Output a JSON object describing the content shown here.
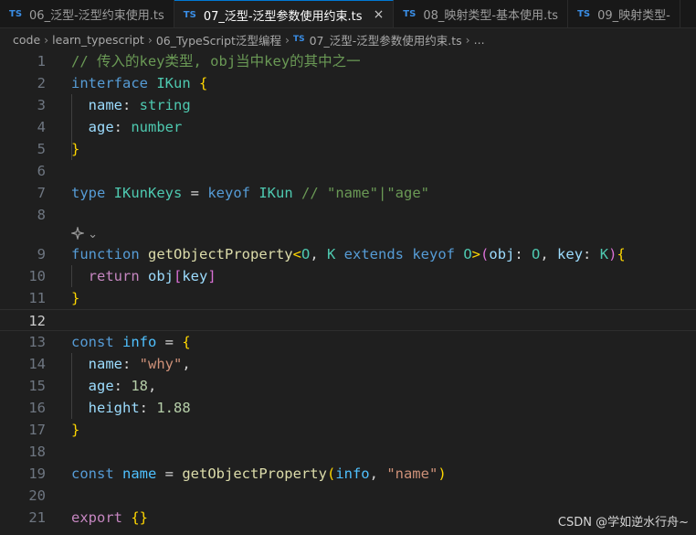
{
  "tabs": [
    {
      "badge": "TS",
      "label": "06_泛型-泛型约束使用.ts",
      "active": false
    },
    {
      "badge": "TS",
      "label": "07_泛型-泛型参数使用约束.ts",
      "active": true,
      "close": "×"
    },
    {
      "badge": "TS",
      "label": "08_映射类型-基本使用.ts",
      "active": false
    },
    {
      "badge": "TS",
      "label": "09_映射类型-",
      "active": false
    }
  ],
  "breadcrumb": {
    "segments": [
      "code",
      "learn_typescript",
      "06_TypeScript泛型编程"
    ],
    "file_badge": "TS",
    "file": "07_泛型-泛型参数使用约束.ts",
    "trailing": "...",
    "separator": "›"
  },
  "codelens": {
    "icon": "sparkle-icon",
    "chevron": "⌄"
  },
  "editor": {
    "current_line": 12,
    "line_numbers": [
      "1",
      "2",
      "3",
      "4",
      "5",
      "6",
      "7",
      "8",
      "9",
      "10",
      "11",
      "12",
      "13",
      "14",
      "15",
      "16",
      "17",
      "18",
      "19",
      "20",
      "21"
    ],
    "lines": [
      [
        [
          "tk-comment",
          "// 传入的key类型, obj当中key的其中之一"
        ]
      ],
      [
        [
          "tk-kw",
          "interface "
        ],
        [
          "tk-type",
          "IKun "
        ],
        [
          "tk-brace",
          "{"
        ]
      ],
      [
        [
          "tk-plain",
          "  "
        ],
        [
          "tk-prop",
          "name"
        ],
        [
          "tk-plain",
          ": "
        ],
        [
          "tk-type",
          "string"
        ]
      ],
      [
        [
          "tk-plain",
          "  "
        ],
        [
          "tk-prop",
          "age"
        ],
        [
          "tk-plain",
          ": "
        ],
        [
          "tk-type",
          "number"
        ]
      ],
      [
        [
          "tk-brace",
          "}"
        ]
      ],
      [],
      [
        [
          "tk-kw",
          "type "
        ],
        [
          "tk-type",
          "IKunKeys"
        ],
        [
          "tk-plain",
          " = "
        ],
        [
          "tk-kw",
          "keyof "
        ],
        [
          "tk-type",
          "IKun "
        ],
        [
          "tk-comment",
          "// \"name\"|\"age\""
        ]
      ],
      [],
      [
        [
          "tk-kw",
          "function "
        ],
        [
          "tk-fn",
          "getObjectProperty"
        ],
        [
          "tk-brace",
          "<"
        ],
        [
          "tk-type",
          "O"
        ],
        [
          "tk-plain",
          ", "
        ],
        [
          "tk-type",
          "K "
        ],
        [
          "tk-kw",
          "extends "
        ],
        [
          "tk-kw",
          "keyof "
        ],
        [
          "tk-type",
          "O"
        ],
        [
          "tk-brace",
          ">"
        ],
        [
          "tk-paren",
          "("
        ],
        [
          "tk-prop",
          "obj"
        ],
        [
          "tk-plain",
          ": "
        ],
        [
          "tk-type",
          "O"
        ],
        [
          "tk-plain",
          ", "
        ],
        [
          "tk-prop",
          "key"
        ],
        [
          "tk-plain",
          ": "
        ],
        [
          "tk-type",
          "K"
        ],
        [
          "tk-paren",
          ")"
        ],
        [
          "tk-brace",
          "{"
        ]
      ],
      [
        [
          "tk-plain",
          "  "
        ],
        [
          "tk-ctrl",
          "return "
        ],
        [
          "tk-prop",
          "obj"
        ],
        [
          "tk-paren",
          "["
        ],
        [
          "tk-prop",
          "key"
        ],
        [
          "tk-paren",
          "]"
        ]
      ],
      [
        [
          "tk-brace",
          "}"
        ]
      ],
      [],
      [
        [
          "tk-kw",
          "const "
        ],
        [
          "tk-var",
          "info"
        ],
        [
          "tk-plain",
          " = "
        ],
        [
          "tk-brace",
          "{"
        ]
      ],
      [
        [
          "tk-plain",
          "  "
        ],
        [
          "tk-prop",
          "name"
        ],
        [
          "tk-plain",
          ": "
        ],
        [
          "tk-str",
          "\"why\""
        ],
        [
          "tk-plain",
          ","
        ]
      ],
      [
        [
          "tk-plain",
          "  "
        ],
        [
          "tk-prop",
          "age"
        ],
        [
          "tk-plain",
          ": "
        ],
        [
          "tk-num",
          "18"
        ],
        [
          "tk-plain",
          ","
        ]
      ],
      [
        [
          "tk-plain",
          "  "
        ],
        [
          "tk-prop",
          "height"
        ],
        [
          "tk-plain",
          ": "
        ],
        [
          "tk-num",
          "1.88"
        ]
      ],
      [
        [
          "tk-brace",
          "}"
        ]
      ],
      [],
      [
        [
          "tk-kw",
          "const "
        ],
        [
          "tk-var",
          "name"
        ],
        [
          "tk-plain",
          " = "
        ],
        [
          "tk-fn",
          "getObjectProperty"
        ],
        [
          "tk-brace",
          "("
        ],
        [
          "tk-var",
          "info"
        ],
        [
          "tk-plain",
          ", "
        ],
        [
          "tk-str",
          "\"name\""
        ],
        [
          "tk-brace",
          ")"
        ]
      ],
      [],
      [
        [
          "tk-ctrl",
          "export "
        ],
        [
          "tk-brace",
          "{}"
        ]
      ]
    ]
  },
  "watermark": "CSDN @学如逆水行舟~"
}
